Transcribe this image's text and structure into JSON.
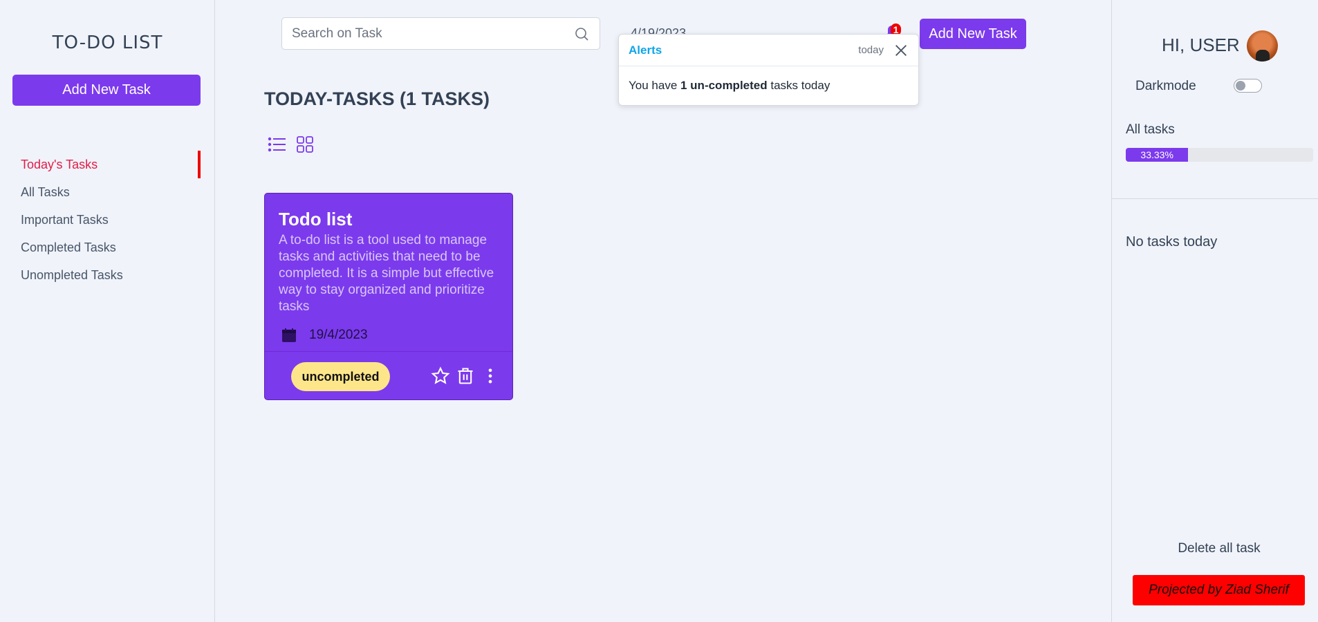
{
  "app": {
    "title": "TO-DO LIST"
  },
  "sidebar": {
    "add_button_label": "Add New Task",
    "items": [
      {
        "label": "Today's Tasks",
        "active": true
      },
      {
        "label": "All Tasks"
      },
      {
        "label": "Important Tasks"
      },
      {
        "label": "Completed Tasks"
      },
      {
        "label": "Unompleted Tasks"
      }
    ]
  },
  "header": {
    "search_placeholder": "Search on Task",
    "date": "4/19/2023",
    "notification_count": "1",
    "add_button_label": "Add New Task"
  },
  "alert": {
    "title": "Alerts",
    "time": "today",
    "message_prefix": "You have ",
    "message_bold": "1 un-completed",
    "message_suffix": " tasks today"
  },
  "main": {
    "section_title": "TODAY-TASKS (1 TASKS)",
    "tasks": [
      {
        "title": "Todo list",
        "description": "A to-do list is a tool used to manage tasks and activities that need to be completed. It is a simple but effective way to stay organized and prioritize tasks",
        "date": "19/4/2023",
        "status": "uncompleted"
      }
    ]
  },
  "right_sidebar": {
    "greeting": "HI, USER",
    "darkmode_label": "Darkmode",
    "darkmode_on": false,
    "all_tasks_label": "All tasks",
    "progress_text": "33.33%",
    "progress_value": 33.33,
    "empty_message": "No tasks today",
    "delete_all_label": "Delete all task",
    "credit": "Projected by Ziad Sherif"
  },
  "colors": {
    "accent": "#7c3aed",
    "active_nav": "#e11d48",
    "status_badge": "#fde68a",
    "credit_bg": "#ff0000",
    "alert_title": "#0ea5e9"
  }
}
